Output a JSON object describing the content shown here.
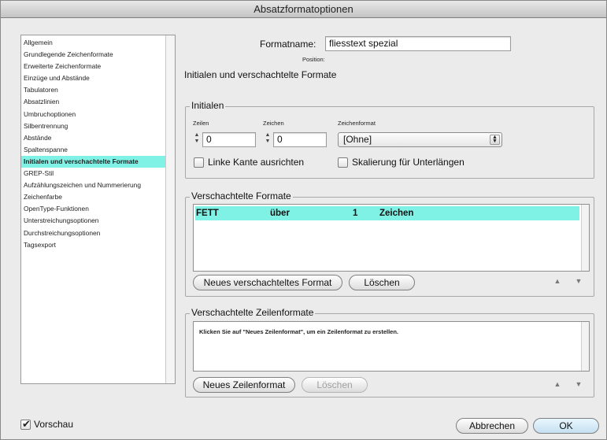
{
  "window": {
    "title": "Absatzformatoptionen"
  },
  "sidebar": {
    "items": [
      "Allgemein",
      "Grundlegende Zeichenformate",
      "Erweiterte Zeichenformate",
      "Einzüge und Abstände",
      "Tabulatoren",
      "Absatzlinien",
      "Umbruchoptionen",
      "Silbentrennung",
      "Abstände",
      "Spaltenspanne",
      "Initialen und verschachtelte Formate",
      "GREP-Stil",
      "Aufzählungszeichen und Nummerierung",
      "Zeichenfarbe",
      "OpenType-Funktionen",
      "Unterstreichungsoptionen",
      "Durchstreichungsoptionen",
      "Tagsexport"
    ],
    "active_index": 10
  },
  "header": {
    "formatname_label": "Formatname:",
    "formatname_value": "fliesstext spezial",
    "position_label": "Position:",
    "section_title": "Initialen und verschachtelte Formate"
  },
  "initialen": {
    "title": "Initialen",
    "zeilen_label": "Zeilen",
    "zeilen_value": "0",
    "zeichen_label": "Zeichen",
    "zeichen_value": "0",
    "zeichenformat_label": "Zeichenformat",
    "zeichenformat_value": "[Ohne]",
    "linke_kante_label": "Linke Kante ausrichten",
    "linke_kante_checked": false,
    "skalierung_label": "Skalierung für Unterlängen",
    "skalierung_checked": false
  },
  "nested": {
    "title": "Verschachtelte Formate",
    "rows": [
      {
        "format": "FETT",
        "mode": "über",
        "count": "1",
        "unit": "Zeichen"
      }
    ],
    "new_button": "Neues verschachteltes Format",
    "delete_button": "Löschen",
    "up_icon": "up-arrow-icon",
    "down_icon": "down-arrow-icon"
  },
  "nested_lines": {
    "title": "Verschachtelte Zeilenformate",
    "hint": "Klicken Sie auf \"Neues Zeilenformat\", um ein Zeilenformat zu erstellen.",
    "new_button": "Neues Zeilenformat",
    "delete_button": "Löschen"
  },
  "footer": {
    "preview_label": "Vorschau",
    "preview_checked": true,
    "cancel_button": "Abbrechen",
    "ok_button": "OK"
  },
  "colors": {
    "selection": "#7ff2e5"
  }
}
